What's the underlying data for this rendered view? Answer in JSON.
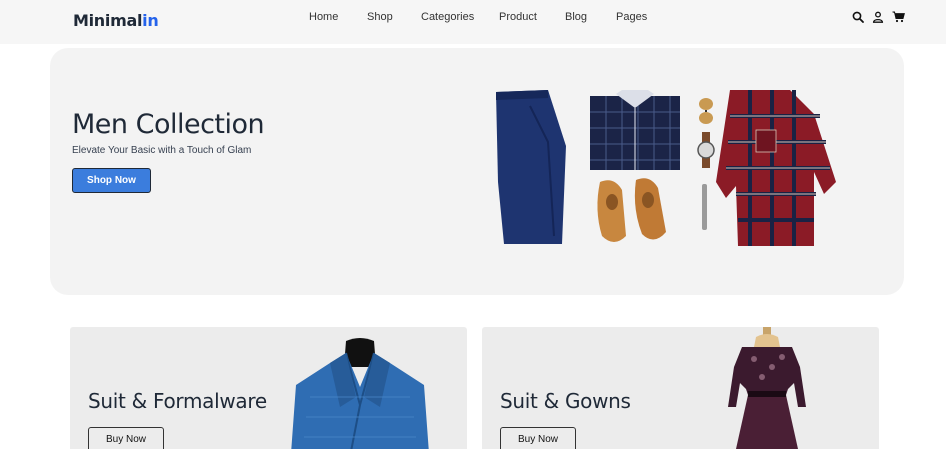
{
  "header": {
    "logo_main": "Minimal",
    "logo_accent": "in",
    "nav": [
      "Home",
      "Shop",
      "Categories",
      "Product",
      "Blog",
      "Pages"
    ],
    "icons": [
      "search-icon",
      "user-icon",
      "cart-icon"
    ]
  },
  "hero": {
    "title": "Men Collection",
    "subtitle": "Elevate Your Basic with a Touch of Glam",
    "button": "Shop Now"
  },
  "categories": [
    {
      "title": "Suit & Formalware",
      "button": "Buy Now"
    },
    {
      "title": "Suit & Gowns",
      "button": "Buy Now"
    }
  ],
  "colors": {
    "accent": "#2563eb",
    "button_primary": "#3b7ddd",
    "hero_bg": "#f3f3f3",
    "card_bg": "#ececec"
  }
}
